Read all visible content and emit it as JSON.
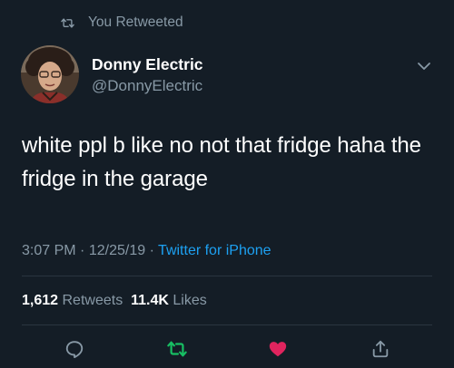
{
  "retweet_context": {
    "label": "You Retweeted",
    "icon": "retweet-icon"
  },
  "author": {
    "display_name": "Donny Electric",
    "handle": "@DonnyElectric",
    "avatar": "avatar-photo"
  },
  "tweet": {
    "text": "white ppl b like no not that fridge haha the fridge in the garage",
    "time": "3:07 PM",
    "date": "12/25/19",
    "separator": "·",
    "source": "Twitter for iPhone"
  },
  "stats": {
    "retweets_count": "1,612",
    "retweets_label": "Retweets",
    "likes_count": "11.4K",
    "likes_label": "Likes"
  },
  "actions": {
    "reply_icon": "reply-icon",
    "retweet_icon": "retweet-icon",
    "like_icon": "heart-icon",
    "share_icon": "share-icon"
  },
  "colors": {
    "background": "#141d26",
    "text_primary": "#ffffff",
    "text_secondary": "#8899a6",
    "link": "#1da1f2",
    "retweet_active": "#17bf63",
    "like_active": "#e0245e",
    "divider": "#2a3540"
  }
}
